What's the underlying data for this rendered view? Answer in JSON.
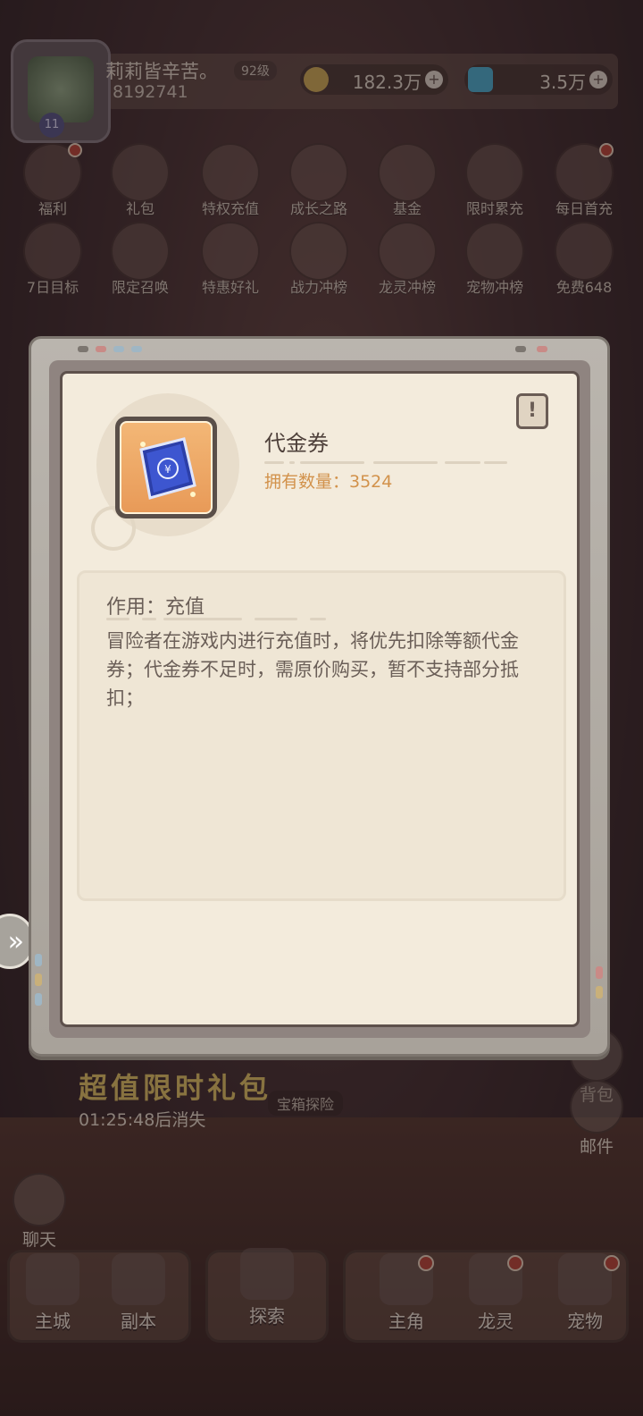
{
  "player": {
    "name": "莉莉皆辛苦。",
    "level": "92级",
    "id": "8192741",
    "avatar_level": "11"
  },
  "resources": {
    "gold": "182.3万",
    "diamond": "3.5万"
  },
  "feature_icons_row1": [
    "福利",
    "礼包",
    "特权充值",
    "成长之路",
    "基金",
    "限时累充",
    "每日首充"
  ],
  "feature_icons_row2": [
    "7日目标",
    "限定召唤",
    "特惠好礼",
    "战力冲榜",
    "龙灵冲榜",
    "宠物冲榜",
    "免费648"
  ],
  "promo": {
    "title": "超值限时礼包",
    "timer": "01:25:48后消失",
    "chest_label": "宝箱探险"
  },
  "side": {
    "bag": "背包",
    "mail": "邮件",
    "chat": "聊天"
  },
  "bottom_nav": [
    "主城",
    "副本",
    "探索",
    "主角",
    "龙灵",
    "宠物"
  ],
  "item_popup": {
    "name": "代金券",
    "owned_label": "拥有数量：3524",
    "info_icon": "info-icon",
    "effect_label": "作用：充值",
    "description": "冒险者在游戏内进行充值时，将优先扣除等额代金券；代金券不足时，需原价购买，暂不支持部分抵扣；"
  },
  "colors": {
    "accent_orange": "#d2924b",
    "badge_red": "#c24a3c",
    "panel_bg": "#f3ebdc"
  }
}
